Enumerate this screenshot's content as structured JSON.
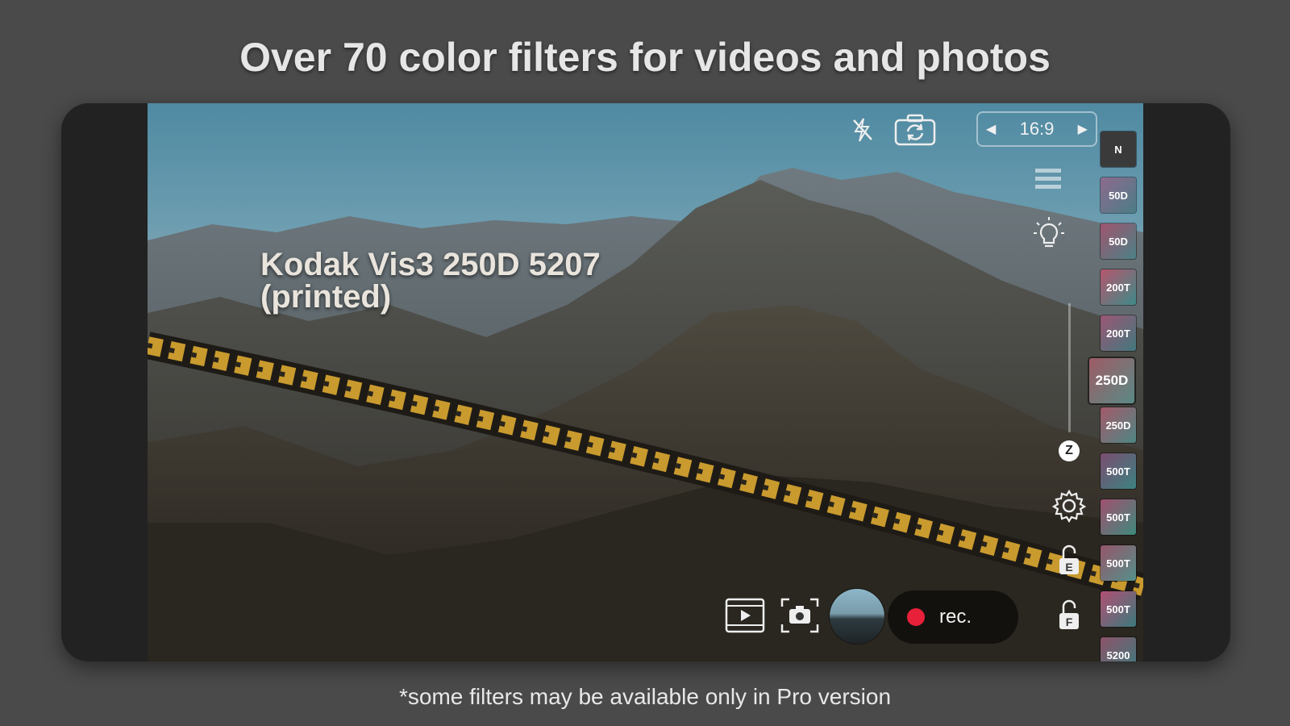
{
  "headline": "Over 70 color filters for videos and photos",
  "footnote": "*some filters may be available only in Pro version",
  "viewfinder": {
    "filter_name_line1": "Kodak Vis3 250D 5207",
    "filter_name_line2": "(printed)"
  },
  "top_bar": {
    "flash_icon": "flash-off-icon",
    "switch_camera_icon": "camera-switch-icon",
    "aspect_ratio": "16:9"
  },
  "side_controls": {
    "menu_icon": "menu-icon",
    "exposure_icon": "lightbulb-icon",
    "zoom_label": "Z",
    "settings_icon": "gear-icon",
    "lock_e_label": "E",
    "lock_f_label": "F"
  },
  "filters": [
    {
      "label": "N",
      "colors": [
        "#3a3a3a",
        "#3a3a3a"
      ]
    },
    {
      "label": "50D",
      "colors": [
        "#8e6a8f",
        "#4b7d86"
      ]
    },
    {
      "label": "50D",
      "colors": [
        "#a0546e",
        "#4a8287"
      ]
    },
    {
      "label": "200T",
      "colors": [
        "#b4566d",
        "#3f8a88"
      ]
    },
    {
      "label": "200T",
      "colors": [
        "#9c5674",
        "#42787e"
      ]
    },
    {
      "label": "250D",
      "colors": [
        "#9e5b65",
        "#5a8a86"
      ],
      "selected": true
    },
    {
      "label": "250D",
      "colors": [
        "#a35a6a",
        "#4e8684"
      ]
    },
    {
      "label": "500T",
      "colors": [
        "#7a4d6f",
        "#3c8282"
      ]
    },
    {
      "label": "500T",
      "colors": [
        "#a0506f",
        "#3e8a7d"
      ]
    },
    {
      "label": "500T",
      "colors": [
        "#95566a",
        "#54908a"
      ]
    },
    {
      "label": "500T",
      "colors": [
        "#b14f73",
        "#3b7a7c"
      ]
    },
    {
      "label": "5200",
      "colors": [
        "#8c5368",
        "#3d7b80"
      ]
    }
  ],
  "bottom_bar": {
    "gallery_icon": "film-play-icon",
    "photo_mode_icon": "camera-icon",
    "rec_label": "rec.",
    "rec_color": "#e8203a"
  }
}
